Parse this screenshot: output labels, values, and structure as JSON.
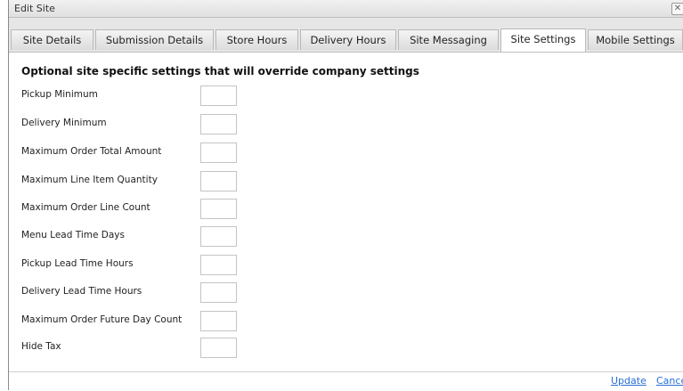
{
  "window": {
    "title": "Edit Site",
    "close_glyph": "✕"
  },
  "tabs": [
    {
      "label": "Site Details",
      "active": false
    },
    {
      "label": "Submission Details",
      "active": false
    },
    {
      "label": "Store Hours",
      "active": false
    },
    {
      "label": "Delivery Hours",
      "active": false
    },
    {
      "label": "Site Messaging",
      "active": false
    },
    {
      "label": "Site Settings",
      "active": true
    },
    {
      "label": "Mobile Settings",
      "active": false
    }
  ],
  "content": {
    "heading": "Optional site specific settings that will override company settings",
    "fields": [
      {
        "label": "Pickup Minimum",
        "value": ""
      },
      {
        "label": "Delivery Minimum",
        "value": ""
      },
      {
        "label": "Maximum Order Total Amount",
        "value": ""
      },
      {
        "label": "Maximum Line Item Quantity",
        "value": ""
      },
      {
        "label": "Maximum Order Line Count",
        "value": ""
      },
      {
        "label": "Menu Lead Time Days",
        "value": ""
      },
      {
        "label": "Pickup Lead Time Hours",
        "value": ""
      },
      {
        "label": "Delivery Lead Time Hours",
        "value": ""
      },
      {
        "label": "Maximum Order Future Day Count",
        "value": ""
      },
      {
        "label": "Hide Tax",
        "value": ""
      }
    ]
  },
  "footer": {
    "update_label": "Update",
    "cancel_label": "Cance"
  }
}
